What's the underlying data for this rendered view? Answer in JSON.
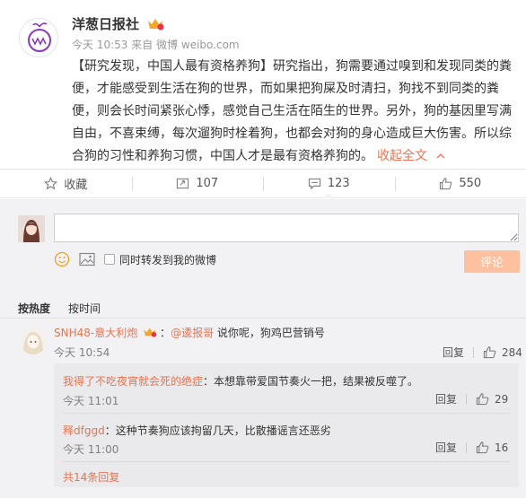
{
  "post": {
    "author": "洋葱日报社",
    "time": "今天 10:53",
    "source_prefix": "来自",
    "source": "微博 weibo.com",
    "tag": "【研究发现，中国人最有资格养狗】",
    "body": "研究指出，狗需要通过嗅到和发现同类的粪便，才能感受到生活在狗的世界，而如果把狗屎及时清扫，狗找不到同类的粪便，则会长时间紧张心悸，感觉自己生活在陌生的世界。另外，狗的基因里写满自由，不喜束缚，每次遛狗时栓着狗，也都会对狗的身心造成巨大伤害。所以综合狗的习性和养狗习惯，中国人才是最有资格养狗的。",
    "collapse_label": "收起全文",
    "accent_color": "#eb7350"
  },
  "actions": {
    "favorite_label": "收藏",
    "repost_count": "107",
    "comment_count": "123",
    "like_count": "550"
  },
  "composer": {
    "placeholder": "",
    "also_repost_label": "同时转发到我的微博",
    "submit_label": "评论",
    "submit_color": "#ffc09f"
  },
  "sort": {
    "by_hot": "按热度",
    "by_time": "按时间"
  },
  "comments": [
    {
      "user": "SNH48-意大利炮",
      "mention": "@逶报哥",
      "text": " 说你呢，狗鸡巴营销号",
      "time": "今天 10:54",
      "reply_label": "回复",
      "likes": "284",
      "replies": [
        {
          "user": "我得了不吃夜宵就会死的绝症",
          "text": "：本想靠带爱国节奏火一把，结果被反噬了。",
          "time": "今天 11:01",
          "reply_label": "回复",
          "likes": "29"
        },
        {
          "user": "释dfggd",
          "text": "：这种节奏狗应该拘留几天，比散播谣言还恶劣",
          "time": "今天 11:00",
          "reply_label": "回复",
          "likes": "16"
        }
      ],
      "more_label": "共14条回复"
    }
  ]
}
